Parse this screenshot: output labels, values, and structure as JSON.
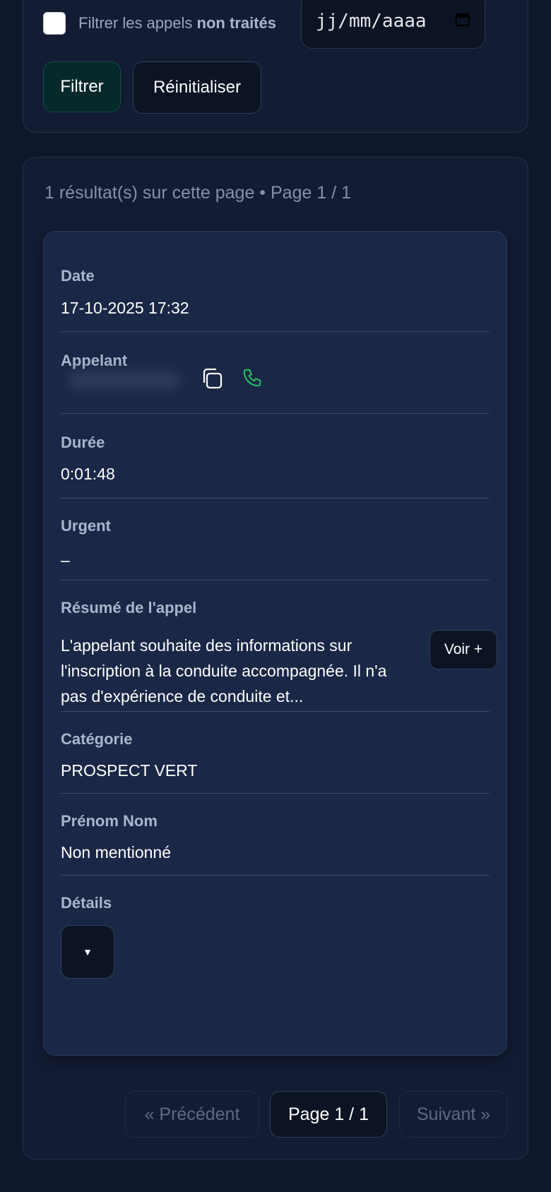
{
  "filters": {
    "checkbox_label_prefix": "Filtrer les appels",
    "checkbox_label_bold": "non traités",
    "date_placeholder": "jj/mm/aaaa",
    "filter_button": "Filtrer",
    "reset_button": "Réinitialiser"
  },
  "results": {
    "summary": "1 résultat(s) sur cette page • Page 1 / 1",
    "card": {
      "date_label": "Date",
      "date_value": "17-10-2025 17:32",
      "caller_label": "Appelant",
      "duration_label": "Durée",
      "duration_value": "0:01:48",
      "urgent_label": "Urgent",
      "urgent_value": "–",
      "summary_label": "Résumé de l'appel",
      "summary_value": "L'appelant souhaite des informations sur l'inscription à la conduite accompagnée. Il n'a pas d'expérience de conduite et...",
      "see_more_button": "Voir +",
      "category_label": "Catégorie",
      "category_value": "PROSPECT VERT",
      "name_label": "Prénom Nom",
      "name_value": "Non mentionné",
      "details_label": "Détails",
      "details_toggle": "▼"
    }
  },
  "pagination": {
    "prev": "« Précédent",
    "current": "Page 1 / 1",
    "next": "Suivant »"
  },
  "colors": {
    "background": "#0f172a",
    "card": "#1b2746",
    "phone_icon": "#22c55e"
  }
}
